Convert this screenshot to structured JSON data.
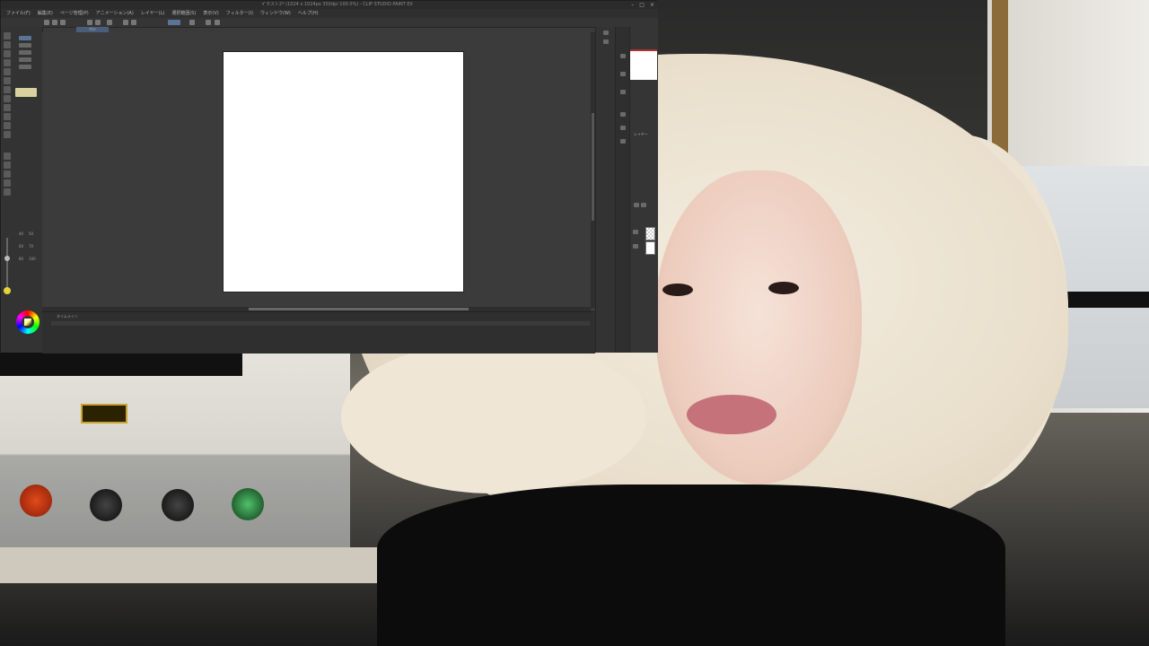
{
  "app": {
    "title": "イラスト2* (1024 x 1024px 350dpi 100.0%) - CLIP STUDIO PAINT EX",
    "window_controls": [
      "–",
      "□",
      "×"
    ],
    "menu": [
      "ファイル(F)",
      "編集(E)",
      "ページ管理(P)",
      "アニメーション(A)",
      "レイヤー(L)",
      "選択範囲(S)",
      "表示(V)",
      "フィルター(I)",
      "ウィンドウ(W)",
      "ヘルプ(H)"
    ],
    "tool_tab_label": "ペン",
    "brush_sizes": [
      "40",
      "50",
      "60",
      "70",
      "80",
      "100"
    ],
    "timeline_label": "タイムライン",
    "right_panel_label": "レイヤー",
    "canvas_color": "#ffffff",
    "accent": "#4a5e7a"
  },
  "video": {
    "machine_plate": "",
    "colors": {
      "hood": "#efe6d6",
      "shirt": "#0c0c0c"
    }
  }
}
